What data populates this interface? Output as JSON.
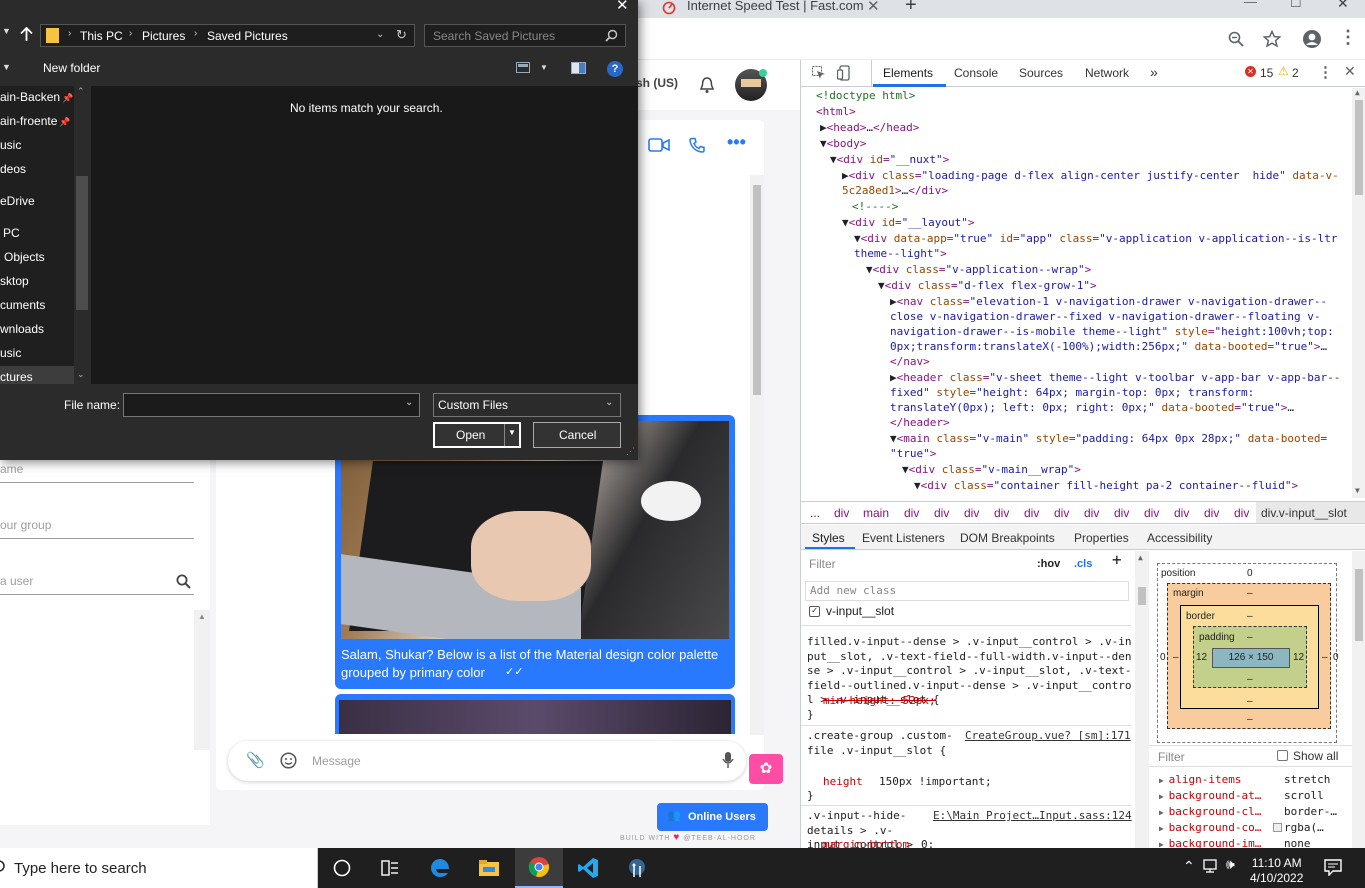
{
  "chrome": {
    "tab_title": "Internet Speed Test | Fast.com",
    "new_tab": "+",
    "win_min": "—",
    "win_max": "☐",
    "win_close": "✕"
  },
  "app": {
    "header_lang": "sh (US)",
    "group_name_placeholder": "ame",
    "group_desc_placeholder": "our group",
    "search_user_placeholder": "a user",
    "message_caption": "Salam, Shukar? Below is a list of the Material design color palette grouped by primary color",
    "message_placeholder": "Message",
    "online_users": "Online Users",
    "build_with": "BUILD WITH",
    "build_author": "@TEEB-AL-HOOR"
  },
  "dialog": {
    "breadcrumb": [
      "This PC",
      "Pictures",
      "Saved Pictures"
    ],
    "search_placeholder": "Search Saved Pictures",
    "new_folder": "New folder",
    "empty_message": "No items match your search.",
    "nav_items": [
      "ain-Backen",
      "ain-froente",
      "usic",
      "deos",
      "eDrive",
      "PC",
      "Objects",
      "sktop",
      "cuments",
      "wnloads",
      "usic",
      "ctures"
    ],
    "file_name_label": "File name:",
    "file_type": "Custom Files",
    "open_label": "Open",
    "cancel_label": "Cancel"
  },
  "devtools": {
    "tabs": [
      "Elements",
      "Console",
      "Sources",
      "Network"
    ],
    "more_tabs": "»",
    "errors": "15",
    "warnings": "2",
    "breadcrumb": [
      "...",
      "div",
      "main",
      "div",
      "div",
      "div",
      "div",
      "div",
      "div",
      "div",
      "div",
      "div",
      "div",
      "div",
      "div",
      "div",
      "div.v-input__slot"
    ],
    "subtabs": [
      "Styles",
      "Event Listeners",
      "DOM Breakpoints",
      "Properties",
      "Accessibility"
    ],
    "filter_placeholder": "Filter",
    "hov": ":hov",
    "cls": ".cls",
    "add_class_placeholder": "Add new class",
    "class_checkbox": "v-input__slot",
    "rule1_selector": "filled.v-input--dense > .v-input__control > .v-input__slot, .v-text-field--full-width.v-input--dense > .v-input__control > .v-input__slot, .v-text-field--outlined.v-input--dense > .v-input__control > .v-input__slot {",
    "rule1_prop": "min-height: 52px;",
    "rule2_selector": ".create-group .custom-file .v-input__slot {",
    "rule2_source": "CreateGroup.vue? [sm]:171",
    "rule2_prop_name": "height",
    "rule2_prop_value": "150px !important;",
    "rule3_selector": ".v-input--hide-details > .v-input__control > .v-input__slot {",
    "rule3_source": "E:\\Main Project…Input.sass:124",
    "rule3_prop_name": "margin-bottom",
    "rule3_prop_value": "0;",
    "box": {
      "position": "position",
      "position_val": "0",
      "margin": "margin",
      "border": "border",
      "padding": "padding",
      "dash": "–",
      "left_pad": "12",
      "right_pad": "12",
      "content": "126 × 150",
      "outer_left": "0",
      "outer_right": "0"
    },
    "computed_filter": "Filter",
    "show_all": "Show all",
    "computed": [
      {
        "name": "align-items",
        "value": "stretch"
      },
      {
        "name": "background-at…",
        "value": "scroll"
      },
      {
        "name": "background-cl…",
        "value": "border-…"
      },
      {
        "name": "background-co…",
        "value": "rgba(…"
      },
      {
        "name": "background-im…",
        "value": "none"
      }
    ]
  },
  "taskbar": {
    "search_placeholder": "Type here to search",
    "time": "11:10 AM",
    "date": "4/10/2022"
  },
  "colors": {
    "accent": "#2979ff",
    "pink": "#ff4da6",
    "dialog_bg": "#2b2b2b",
    "taskbar": "#1f1f1f"
  }
}
